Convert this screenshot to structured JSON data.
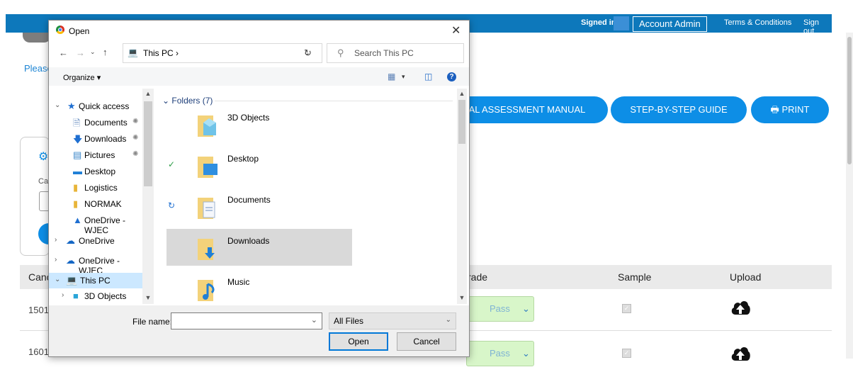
{
  "app": {
    "signed_in_label": "Signed in a:",
    "account_admin": "Account Admin",
    "terms": "Terms & Conditions",
    "sign_out": "Sign out",
    "please_text": "Please",
    "buttons": {
      "manual": "AL ASSESSMENT MANUAL",
      "guide": "STEP-BY-STEP GUIDE",
      "print": "PRINT"
    },
    "card_label": "Ca",
    "table": {
      "headers": {
        "cand": "Canc",
        "grade": "rade",
        "sample": "Sample",
        "upload": "Upload"
      },
      "rows": [
        {
          "cand": "1501",
          "grade": "Pass",
          "sample_checked": true
        },
        {
          "cand": "1601",
          "grade": "Pass",
          "sample_checked": true
        }
      ]
    }
  },
  "dialog": {
    "title": "Open",
    "address": {
      "path": "This PC  ›"
    },
    "search": {
      "placeholder": "Search This PC"
    },
    "organize": "Organize ▾",
    "nav": [
      {
        "label": "Quick access",
        "icon": "star-icon"
      },
      {
        "label": "Documents",
        "icon": "documents-icon",
        "pinned": true
      },
      {
        "label": "Downloads",
        "icon": "downloads-icon",
        "pinned": true
      },
      {
        "label": "Pictures",
        "icon": "pictures-icon",
        "pinned": true
      },
      {
        "label": "Desktop",
        "icon": "desktop-icon"
      },
      {
        "label": "Logistics",
        "icon": "folder-icon"
      },
      {
        "label": "NORMAK",
        "icon": "folder-icon"
      },
      {
        "label": "OneDrive - WJEC",
        "icon": "onedrive-folder-icon"
      },
      {
        "label": "OneDrive",
        "icon": "cloud-icon"
      },
      {
        "label": "OneDrive - WJEC",
        "icon": "cloud-icon"
      },
      {
        "label": "This PC",
        "icon": "this-pc-icon"
      },
      {
        "label": "3D Objects",
        "icon": "3d-objects-icon"
      }
    ],
    "group_header": "Folders (7)",
    "folders": [
      {
        "label": "3D Objects",
        "status": ""
      },
      {
        "label": "Desktop",
        "status": "synced"
      },
      {
        "label": "Documents",
        "status": "syncing"
      },
      {
        "label": "Downloads",
        "status": ""
      },
      {
        "label": "Music",
        "status": ""
      }
    ],
    "file_name_label": "File name:",
    "file_name_value": "",
    "file_type": "All Files",
    "open_button": "Open",
    "cancel_button": "Cancel"
  },
  "colors": {
    "accent": "#0d8ee6",
    "topbar": "#0d78bb",
    "selection": "#cce8ff"
  }
}
